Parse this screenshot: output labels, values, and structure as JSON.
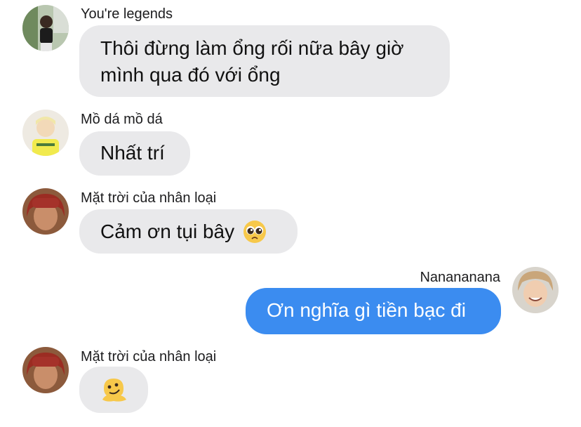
{
  "messages": [
    {
      "sender": "You're legends",
      "text": "Thôi đừng làm ổng rối nữa bây giờ mình qua đó với ổng",
      "direction": "incoming",
      "avatar": "avatar-boy-outdoor"
    },
    {
      "sender": "Mồ dá mồ dá",
      "text": "Nhất trí",
      "direction": "incoming",
      "avatar": "avatar-blond-yellow-shirt"
    },
    {
      "sender": "Mặt trời của nhân loại",
      "text": "Cảm ơn tụi bây",
      "emoji": "pleading-face-emoji",
      "direction": "incoming",
      "avatar": "avatar-red-hair"
    },
    {
      "sender": "Nanananana",
      "text": "Ơn nghĩa gì tiền bạc đi",
      "direction": "outgoing",
      "avatar": "avatar-smiling-boy"
    },
    {
      "sender": "Mặt trời của nhân loại",
      "text": "",
      "emoji": "melting-face-emoji",
      "direction": "incoming",
      "avatar": "avatar-red-hair"
    }
  ],
  "colors": {
    "incoming_bubble": "#e9e9eb",
    "outgoing_bubble": "#3b8cf0",
    "outgoing_text": "#ffffff"
  }
}
